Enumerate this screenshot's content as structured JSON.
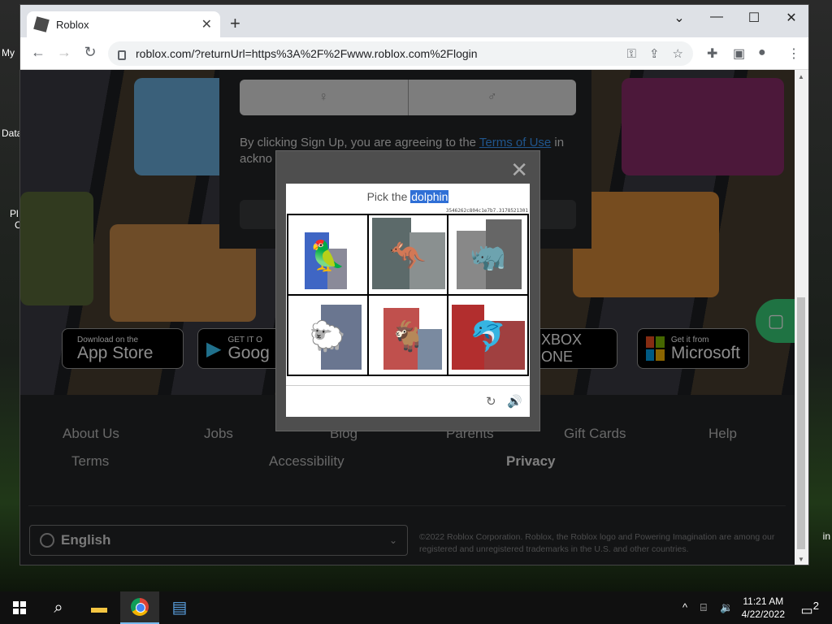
{
  "desktop": {
    "left_labels": [
      "My",
      "Data",
      "Pl",
      "C"
    ],
    "right_label": "in"
  },
  "browser": {
    "tab_title": "Roblox",
    "url": "roblox.com/?returnUrl=https%3A%2F%2Fwww.roblox.com%2Flogin"
  },
  "signup": {
    "terms_prefix": "By clicking Sign Up, you are agreeing to the ",
    "terms_link": "Terms of Use",
    "terms_suffix_1": " in",
    "terms_line3": "ackno"
  },
  "badges": {
    "appstore_small": "Download on the",
    "appstore_big": "App Store",
    "google_small": "GET IT O",
    "google_big": "Goog",
    "xbox": "XBOX ONE",
    "microsoft_small": "Get it from",
    "microsoft_big": "Microsoft"
  },
  "footer": {
    "links": [
      "About Us",
      "Jobs",
      "Blog",
      "Parents",
      "Gift Cards",
      "Help",
      "Terms",
      "Accessibility",
      "Privacy"
    ],
    "language": "English",
    "copyright": "©2022 Roblox Corporation. Roblox, the Roblox logo and Powering Imagination are among our registered and unregistered trademarks in the U.S. and other countries."
  },
  "captcha": {
    "prompt_prefix": "Pick the ",
    "prompt_target": "dolphin",
    "hash": "3546262c804c1e7b7.3178521301",
    "cells": [
      {
        "animal": "cockatoo",
        "glyph": "🦜"
      },
      {
        "animal": "kangaroo",
        "glyph": "🦘"
      },
      {
        "animal": "rhino",
        "glyph": "🦏"
      },
      {
        "animal": "sheep",
        "glyph": "🐑"
      },
      {
        "animal": "goat",
        "glyph": "🐐"
      },
      {
        "animal": "dolphin",
        "glyph": "🐬"
      }
    ]
  },
  "taskbar": {
    "time": "11:21 AM",
    "date": "4/22/2022",
    "notification_count": "2"
  }
}
